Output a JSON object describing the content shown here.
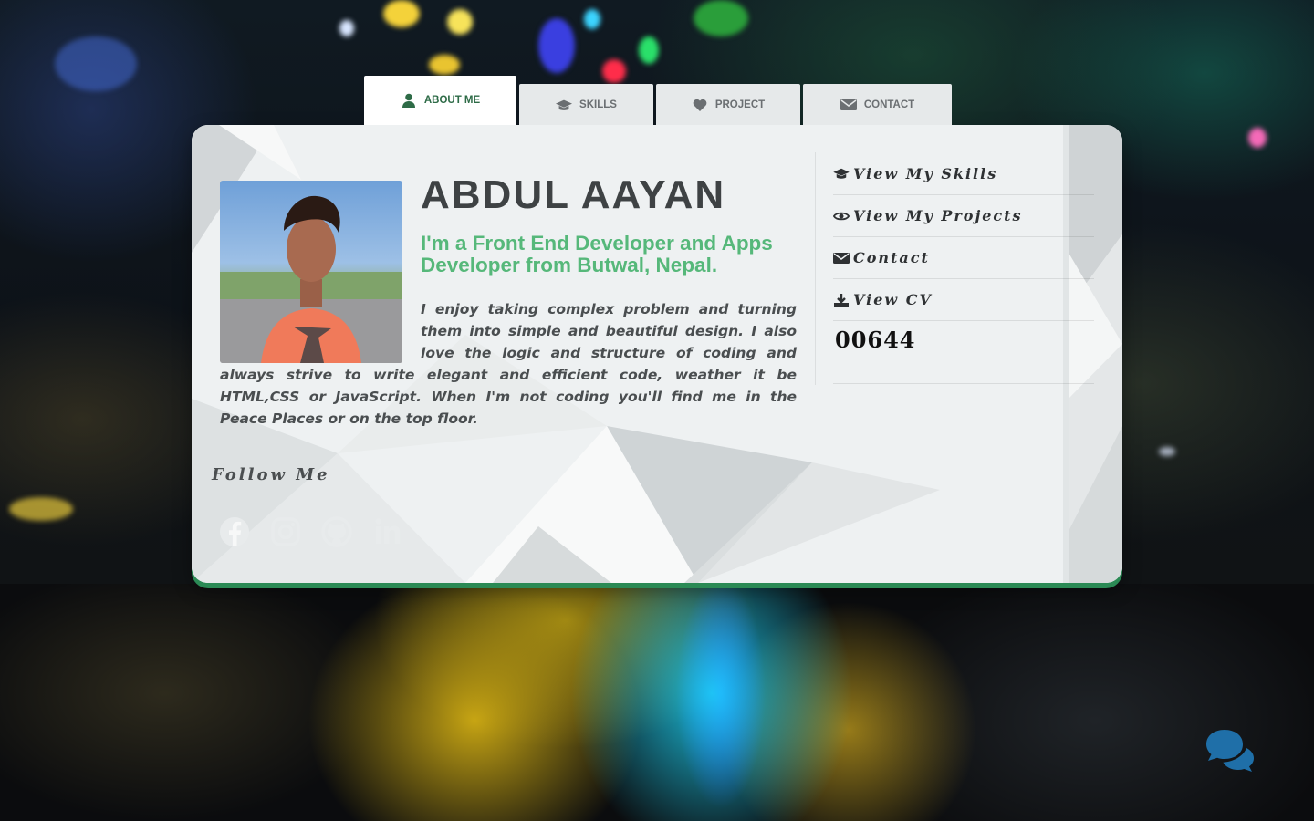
{
  "tabs": [
    {
      "label": "About Me",
      "icon": "user-icon",
      "active": true
    },
    {
      "label": "Skills",
      "icon": "graduation-cap-icon",
      "active": false
    },
    {
      "label": "Project",
      "icon": "heart-icon",
      "active": false
    },
    {
      "label": "Contact",
      "icon": "envelope-icon",
      "active": false
    }
  ],
  "profile": {
    "name": "ABDUL AAYAN",
    "tagline": "I'm a Front End Developer and Apps Developer from Butwal, Nepal.",
    "bio": "I enjoy taking complex problem and turning them into simple and beautiful design. I also love the logic and structure of coding and always strive to write elegant and efficient code, weather it be HTML,CSS or JavaScript. When I'm not coding you'll find me in the Peace Places or on the top floor.",
    "photo_icon": "profile-photo"
  },
  "follow": {
    "title": "Follow Me",
    "icons": [
      "facebook-icon",
      "instagram-icon",
      "github-icon",
      "linkedin-icon"
    ]
  },
  "sidebar": {
    "items": [
      {
        "label": "View My Skills",
        "icon": "graduation-cap-icon"
      },
      {
        "label": "View My Projects",
        "icon": "eye-icon"
      },
      {
        "label": "Contact",
        "icon": "envelope-icon"
      },
      {
        "label": "View CV",
        "icon": "download-icon"
      }
    ],
    "visitor_count": "00644"
  },
  "chat_icon": "chat-bubbles-icon",
  "colors": {
    "accent_green": "#56b87a",
    "dark_green": "#2e6b47",
    "card_border": "#2b8a55",
    "chat_blue": "#1f6fa8"
  }
}
